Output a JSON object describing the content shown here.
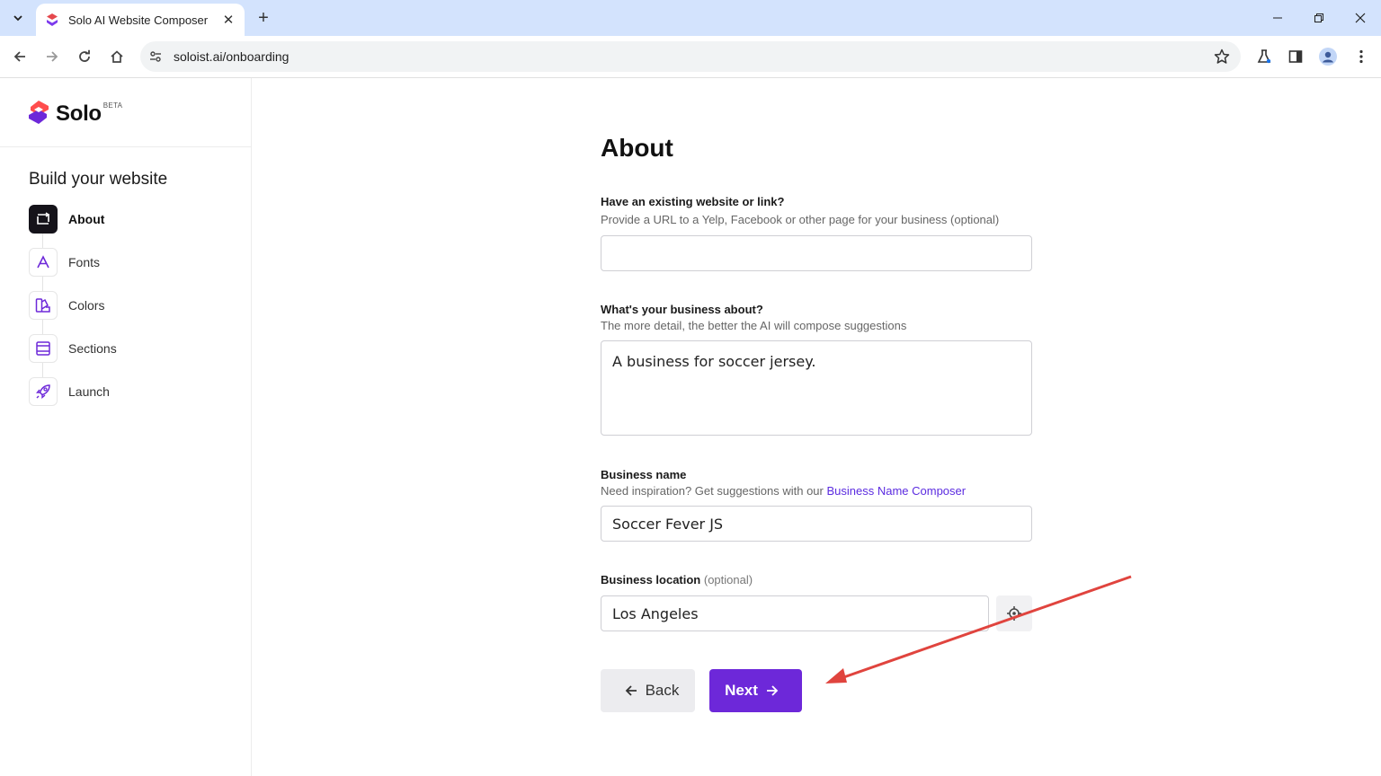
{
  "browser": {
    "tab_title": "Solo AI Website Composer",
    "url": "soloist.ai/onboarding"
  },
  "sidebar": {
    "brand": "Solo",
    "beta": "BETA",
    "heading": "Build your website",
    "steps": [
      {
        "label": "About",
        "icon": "about-icon",
        "active": true
      },
      {
        "label": "Fonts",
        "icon": "fonts-icon"
      },
      {
        "label": "Colors",
        "icon": "colors-icon"
      },
      {
        "label": "Sections",
        "icon": "sections-icon"
      },
      {
        "label": "Launch",
        "icon": "rocket-icon"
      }
    ]
  },
  "form": {
    "title": "About",
    "website": {
      "label": "Have an existing website or link?",
      "help": "Provide a URL to a Yelp, Facebook or other page for your business (optional)",
      "value": ""
    },
    "about": {
      "label": "What's your business about?",
      "help": "The more detail, the better the AI will compose suggestions",
      "value": "A business for soccer jersey."
    },
    "name": {
      "label": "Business name",
      "help_prefix": "Need inspiration? Get suggestions with our ",
      "help_link": "Business Name Composer",
      "value": "Soccer Fever JS"
    },
    "location": {
      "label": "Business location",
      "optional": "(optional)",
      "value": "Los Angeles"
    },
    "back_label": "Back",
    "next_label": "Next"
  },
  "colors": {
    "accent": "#6d28d9",
    "annotation_arrow": "#e0443e"
  }
}
